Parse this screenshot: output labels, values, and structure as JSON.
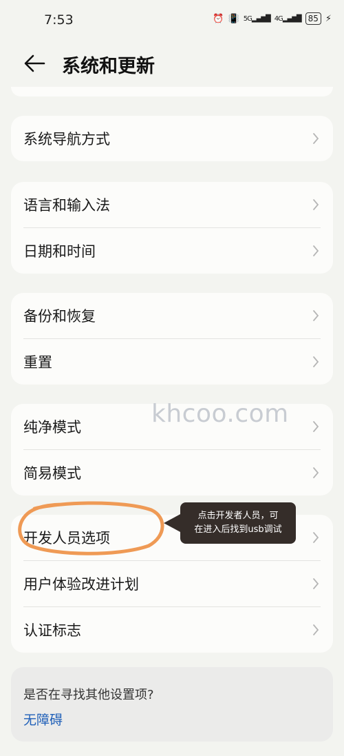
{
  "status_bar": {
    "time": "7:53",
    "net1": "5G",
    "net2": "4G",
    "battery": "85"
  },
  "header": {
    "title": "系统和更新"
  },
  "groups": [
    {
      "items": [
        "系统导航方式"
      ]
    },
    {
      "items": [
        "语言和输入法",
        "日期和时间"
      ]
    },
    {
      "items": [
        "备份和恢复",
        "重置"
      ]
    },
    {
      "items": [
        "纯净模式",
        "简易模式"
      ]
    },
    {
      "items": [
        "开发人员选项",
        "用户体验改进计划",
        "认证标志"
      ]
    }
  ],
  "footer": {
    "question": "是否在寻找其他设置项?",
    "link": "无障碍"
  },
  "watermark": "khcoo.com",
  "tooltip": {
    "line1": "点击开发者人员，可",
    "line2": "在进入后找到usb调试"
  },
  "colors": {
    "background": "#f3f4f0",
    "card": "#fcfcfa",
    "link": "#1f5fb8",
    "tooltip_bg": "#352d29",
    "annotation_circle": "#ef9a55"
  }
}
